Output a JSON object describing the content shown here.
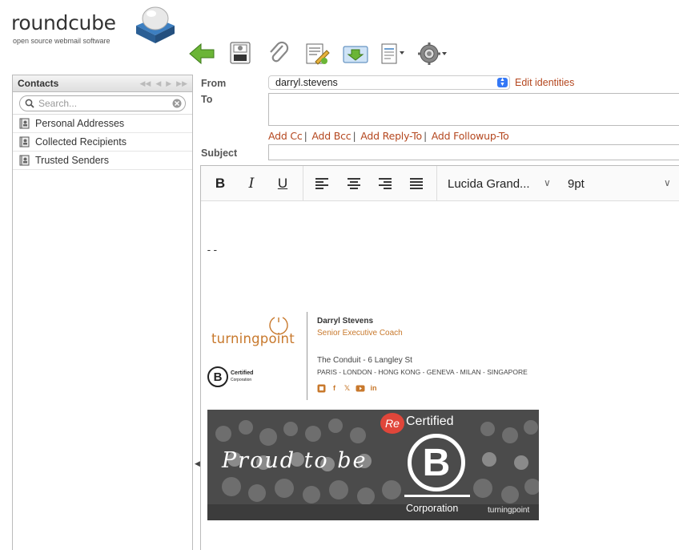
{
  "logo": {
    "name": "roundcube",
    "tagline": "open source webmail software"
  },
  "toolbar": {
    "buttons": [
      {
        "name": "back",
        "icon": "back-arrow-icon"
      },
      {
        "name": "save",
        "icon": "save-icon"
      },
      {
        "name": "attach",
        "icon": "paperclip-icon"
      },
      {
        "name": "signature",
        "icon": "signature-icon"
      },
      {
        "name": "responses",
        "icon": "responses-icon"
      },
      {
        "name": "spellcheck",
        "icon": "document-icon"
      },
      {
        "name": "options",
        "icon": "gear-icon"
      }
    ]
  },
  "contacts": {
    "title": "Contacts",
    "search_placeholder": "Search...",
    "groups": [
      {
        "label": "Personal Addresses"
      },
      {
        "label": "Collected Recipients"
      },
      {
        "label": "Trusted Senders"
      }
    ]
  },
  "compose": {
    "from_label": "From",
    "from_value": "darryl.stevens",
    "edit_identities": "Edit identities",
    "to_label": "To",
    "to_value": "",
    "add_cc": "Add Cc",
    "add_bcc": "Add Bcc",
    "add_reply_to": "Add Reply-To",
    "add_followup_to": "Add Followup-To",
    "subject_label": "Subject",
    "subject_value": ""
  },
  "editor": {
    "bold": "B",
    "italic": "I",
    "underline": "U",
    "font_name": "Lucida Grand...",
    "font_size": "9pt",
    "signature_delimiter": "--"
  },
  "signature": {
    "company_word": "turningpoint",
    "bcorp_line1": "Certified",
    "bcorp_line2": "Corporation",
    "name": "Darryl Stevens",
    "role": "Senior Executive Coach",
    "address": "The Conduit - 6 Langley St",
    "cities": "PARIS - LONDON - HONG KONG - GENEVA - MILAN - SINGAPORE",
    "banner_script": "Proud to be",
    "banner_certified": "Certified",
    "banner_re": "Re",
    "banner_b": "B",
    "banner_corporation": "Corporation",
    "banner_brand": "turningpoint"
  },
  "colors": {
    "link": "#b4471f",
    "brand_orange": "#c8792d",
    "toolbar_green": "#5aa02c"
  }
}
